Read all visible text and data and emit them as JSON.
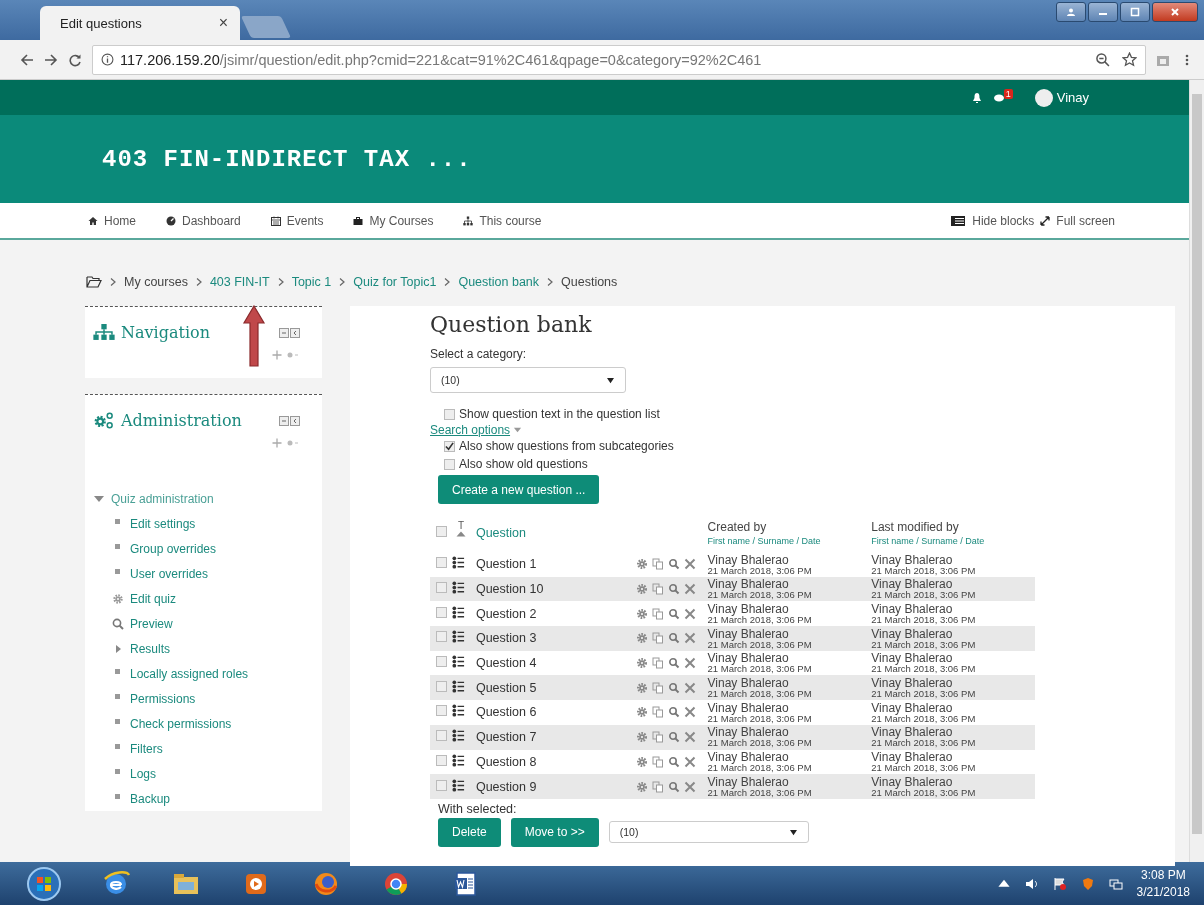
{
  "browser": {
    "tab_title": "Edit questions",
    "tab_close": "×",
    "url_host": "117.206.159.20",
    "url_path": "/jsimr/question/edit.php?cmid=221&cat=91%2C461&qpage=0&category=92%2C461"
  },
  "topbar": {
    "message_count": "1",
    "user": "Vinay"
  },
  "site_title": "403 FIN-INDIRECT TAX ...",
  "nav": [
    {
      "label": "Home",
      "kind": "home"
    },
    {
      "label": "Dashboard",
      "kind": "dashboard"
    },
    {
      "label": "Events",
      "kind": "calendar"
    },
    {
      "label": "My Courses",
      "kind": "briefcase"
    },
    {
      "label": "This course",
      "kind": "sitemap"
    }
  ],
  "nav_right": [
    {
      "label": "Hide blocks",
      "kind": "list"
    },
    {
      "label": "Full screen",
      "kind": "expand"
    }
  ],
  "breadcrumb": [
    {
      "label": "My courses",
      "link": false
    },
    {
      "label": "403 FIN-IT",
      "link": true
    },
    {
      "label": "Topic 1",
      "link": true
    },
    {
      "label": "Quiz for Topic1",
      "link": true
    },
    {
      "label": "Question bank",
      "link": true
    },
    {
      "label": "Questions",
      "link": false
    }
  ],
  "blocks": [
    {
      "title": "Navigation",
      "kind": "navigation"
    },
    {
      "title": "Administration",
      "kind": "administration"
    }
  ],
  "admin_tree": {
    "label": "Quiz administration",
    "expanded": true,
    "children": [
      {
        "label": "Edit settings",
        "kind": "leaf"
      },
      {
        "label": "Group overrides",
        "kind": "leaf"
      },
      {
        "label": "User overrides",
        "kind": "leaf"
      },
      {
        "label": "Edit quiz",
        "kind": "gear"
      },
      {
        "label": "Preview",
        "kind": "search"
      },
      {
        "label": "Results",
        "kind": "branch"
      },
      {
        "label": "Locally assigned roles",
        "kind": "leaf"
      },
      {
        "label": "Permissions",
        "kind": "leaf"
      },
      {
        "label": "Check permissions",
        "kind": "leaf"
      },
      {
        "label": "Filters",
        "kind": "leaf"
      },
      {
        "label": "Logs",
        "kind": "leaf"
      },
      {
        "label": "Backup",
        "kind": "leaf"
      }
    ]
  },
  "main": {
    "title": "Question bank",
    "category_label": "Select a category:",
    "category_value": "(10)",
    "show_text": {
      "label": "Show question text in the question list",
      "checked": false
    },
    "search_options": "Search options",
    "options": [
      {
        "label": "Also show questions from subcategories",
        "checked": true
      },
      {
        "label": "Also show old questions",
        "checked": false
      }
    ],
    "create_button": "Create a new question ...",
    "table": {
      "select_all_checked": false,
      "type_column": "T",
      "columns": [
        {
          "label": "Question"
        },
        {
          "label": "Created by",
          "sort": "First name / Surname / Date"
        },
        {
          "label": "Last modified by",
          "sort": "First name / Surname / Date"
        }
      ],
      "rows": [
        {
          "name": "Question 1",
          "checked": false,
          "created_by": "Vinay Bhalerao",
          "created_date": "21 March 2018, 3:06 PM",
          "modified_by": "Vinay Bhalerao",
          "modified_date": "21 March 2018, 3:06 PM"
        },
        {
          "name": "Question 10",
          "checked": false,
          "created_by": "Vinay Bhalerao",
          "created_date": "21 March 2018, 3:06 PM",
          "modified_by": "Vinay Bhalerao",
          "modified_date": "21 March 2018, 3:06 PM"
        },
        {
          "name": "Question 2",
          "checked": false,
          "created_by": "Vinay Bhalerao",
          "created_date": "21 March 2018, 3:06 PM",
          "modified_by": "Vinay Bhalerao",
          "modified_date": "21 March 2018, 3:06 PM"
        },
        {
          "name": "Question 3",
          "checked": false,
          "created_by": "Vinay Bhalerao",
          "created_date": "21 March 2018, 3:06 PM",
          "modified_by": "Vinay Bhalerao",
          "modified_date": "21 March 2018, 3:06 PM"
        },
        {
          "name": "Question 4",
          "checked": false,
          "created_by": "Vinay Bhalerao",
          "created_date": "21 March 2018, 3:06 PM",
          "modified_by": "Vinay Bhalerao",
          "modified_date": "21 March 2018, 3:06 PM"
        },
        {
          "name": "Question 5",
          "checked": false,
          "created_by": "Vinay Bhalerao",
          "created_date": "21 March 2018, 3:06 PM",
          "modified_by": "Vinay Bhalerao",
          "modified_date": "21 March 2018, 3:06 PM"
        },
        {
          "name": "Question 6",
          "checked": false,
          "created_by": "Vinay Bhalerao",
          "created_date": "21 March 2018, 3:06 PM",
          "modified_by": "Vinay Bhalerao",
          "modified_date": "21 March 2018, 3:06 PM"
        },
        {
          "name": "Question 7",
          "checked": false,
          "created_by": "Vinay Bhalerao",
          "created_date": "21 March 2018, 3:06 PM",
          "modified_by": "Vinay Bhalerao",
          "modified_date": "21 March 2018, 3:06 PM"
        },
        {
          "name": "Question 8",
          "checked": false,
          "created_by": "Vinay Bhalerao",
          "created_date": "21 March 2018, 3:06 PM",
          "modified_by": "Vinay Bhalerao",
          "modified_date": "21 March 2018, 3:06 PM"
        },
        {
          "name": "Question 9",
          "checked": false,
          "created_by": "Vinay Bhalerao",
          "created_date": "21 March 2018, 3:06 PM",
          "modified_by": "Vinay Bhalerao",
          "modified_date": "21 March 2018, 3:06 PM"
        }
      ]
    },
    "with_selected": "With selected:",
    "actions": [
      "Delete",
      "Move to >>"
    ],
    "move_target": "(10)"
  },
  "taskbar": {
    "time": "3:08 PM",
    "date": "3/21/2018",
    "apps": [
      {
        "kind": "globe"
      },
      {
        "kind": "folder"
      },
      {
        "kind": "play"
      },
      {
        "kind": "fox"
      },
      {
        "kind": "wheel"
      },
      {
        "kind": "document"
      }
    ]
  }
}
